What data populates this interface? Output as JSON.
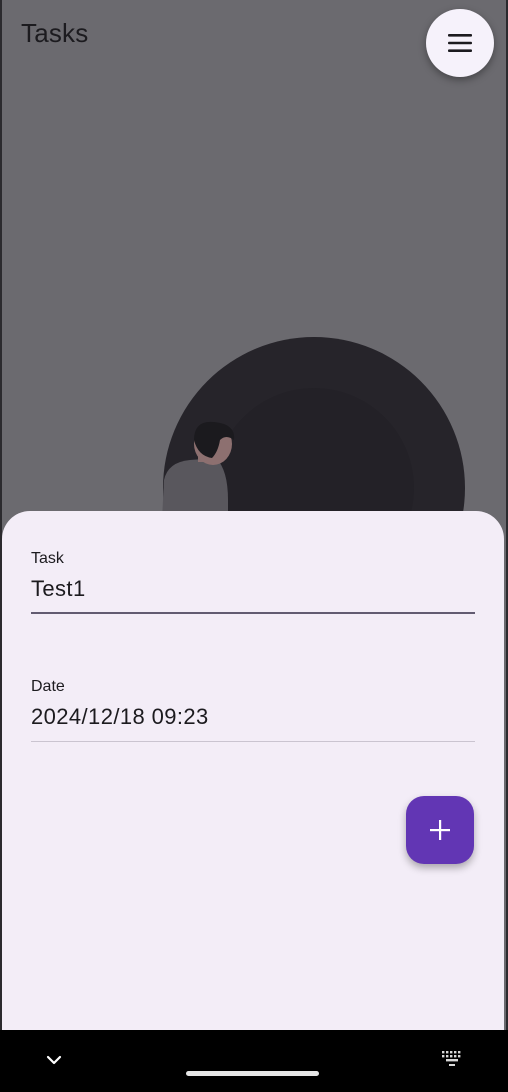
{
  "app_bar": {
    "title": "Tasks",
    "menu_icon": "hamburger-menu-icon"
  },
  "illustration": {
    "subject": "person-beside-dark-circle"
  },
  "form": {
    "task": {
      "label": "Task",
      "value": "Test1"
    },
    "date": {
      "label": "Date",
      "value": "2024/12/18 09:23"
    },
    "add_icon": "plus-icon"
  },
  "nav_bar": {
    "back_icon": "chevron-down-icon",
    "keyboard_icon": "keyboard-icon"
  },
  "colors": {
    "scrim": "#6b6a6f",
    "sheet": "#f3edf7",
    "fab": "#6236b4",
    "focused_underline": "#625b71"
  }
}
